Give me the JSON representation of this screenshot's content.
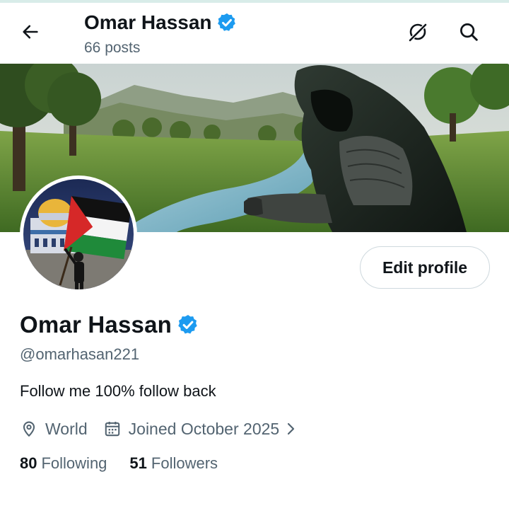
{
  "header": {
    "name": "Omar Hassan",
    "posts": "66 posts",
    "icons": {
      "back": "arrow-left-icon",
      "grok": "grok-icon",
      "search": "search-icon"
    }
  },
  "banner": {
    "description_icon": "banner-image"
  },
  "profile": {
    "display_name": "Omar Hassan",
    "handle": "@omarhasan221",
    "bio": "Follow me 100% follow back",
    "location": "World",
    "joined": "Joined October 2025",
    "verified": true,
    "edit_label": "Edit profile"
  },
  "stats": {
    "following_count": "80",
    "following_label": "Following",
    "followers_count": "51",
    "followers_label": "Followers"
  },
  "colors": {
    "verified_badge": "#1d9bf0",
    "secondary_text": "#536471",
    "primary_text": "#0f1419",
    "border": "#cfd9de"
  }
}
